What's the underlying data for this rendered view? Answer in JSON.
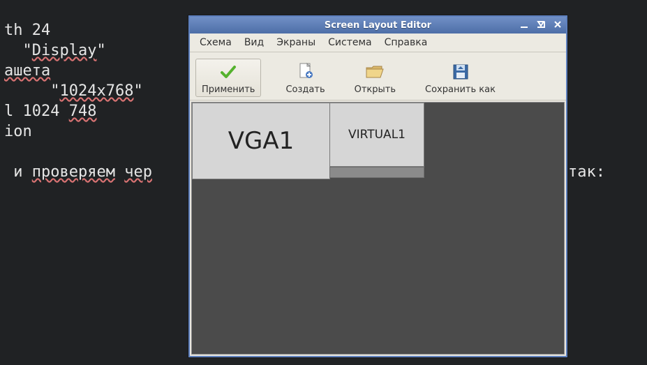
{
  "terminal_lines": [
    "th 24",
    "  \"Display\"",
    "ашета",
    "     \"1024x768\"",
    "l 1024 748",
    "ion",
    "",
    " и проверяем чер                                          но так:"
  ],
  "terminal_underline_words": [
    "Display",
    "ашета",
    "1024x768",
    "748",
    "проверяем",
    "чер"
  ],
  "terminal_line0_prefix": "",
  "window": {
    "title": "Screen Layout Editor",
    "menu": [
      "Схема",
      "Вид",
      "Экраны",
      "Система",
      "Справка"
    ],
    "toolbar": {
      "apply": "Применить",
      "create": "Создать",
      "open": "Открыть",
      "saveas": "Сохранить как"
    },
    "screens": {
      "vga": "VGA1",
      "virtual": "VIRTUAL1"
    }
  }
}
